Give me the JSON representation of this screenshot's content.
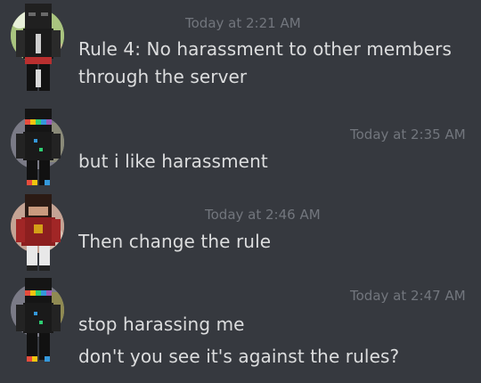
{
  "messages": [
    {
      "timestamp": "Today at 2:21 AM",
      "lines": [
        "Rule 4: No harassment to other members",
        "through the server"
      ]
    },
    {
      "timestamp": "Today at 2:35 AM",
      "lines": [
        "but i like harassment"
      ]
    },
    {
      "timestamp": "Today at 2:46 AM",
      "lines": [
        "Then change the rule"
      ]
    },
    {
      "timestamp": "Today at 2:47 AM",
      "lines": [
        "stop harassing me",
        "don't you see it's against the rules?"
      ]
    }
  ],
  "avatars": [
    {
      "icon": "minecraft-skin-dark-avatar",
      "accent": "#9fd356"
    },
    {
      "icon": "minecraft-skin-rainbow-avatar",
      "accent": "#22a7f0"
    },
    {
      "icon": "minecraft-skin-red-avatar",
      "accent": "#c0392b"
    },
    {
      "icon": "minecraft-skin-rainbow-avatar",
      "accent": "#22a7f0"
    }
  ]
}
